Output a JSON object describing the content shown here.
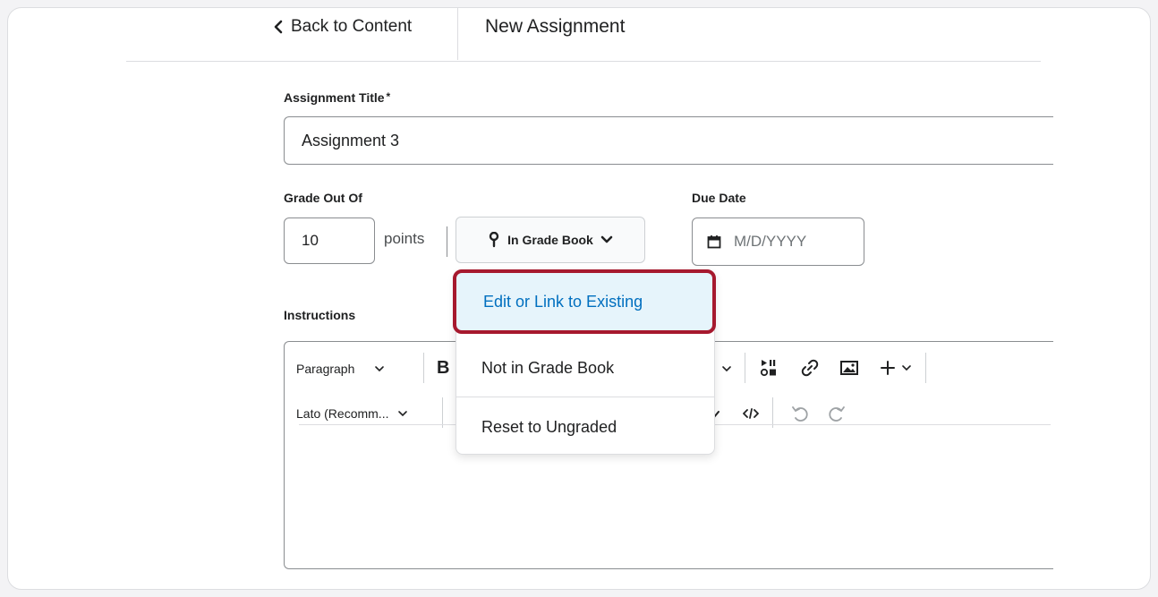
{
  "header": {
    "back_label": "Back to Content",
    "title": "New Assignment"
  },
  "form": {
    "title_label": "Assignment Title",
    "title_required": "*",
    "title_value": "Assignment 3",
    "grade_label": "Grade Out Of",
    "grade_value": "10",
    "points_label": "points",
    "grade_book_button": "In Grade Book",
    "due_label": "Due Date",
    "due_placeholder": "M/D/YYYY",
    "instructions_label": "Instructions"
  },
  "editor": {
    "format_select": "Paragraph",
    "font_select": "Lato (Recomm..."
  },
  "grade_menu": {
    "items": [
      {
        "label": "Edit or Link to Existing",
        "highlighted": true
      },
      {
        "label": "Not in Grade Book"
      },
      {
        "label": "Reset to Ungraded"
      }
    ]
  },
  "colors": {
    "highlight_border": "#a6192e",
    "highlight_bg": "#e6f4fb",
    "link_blue": "#006fbf"
  }
}
